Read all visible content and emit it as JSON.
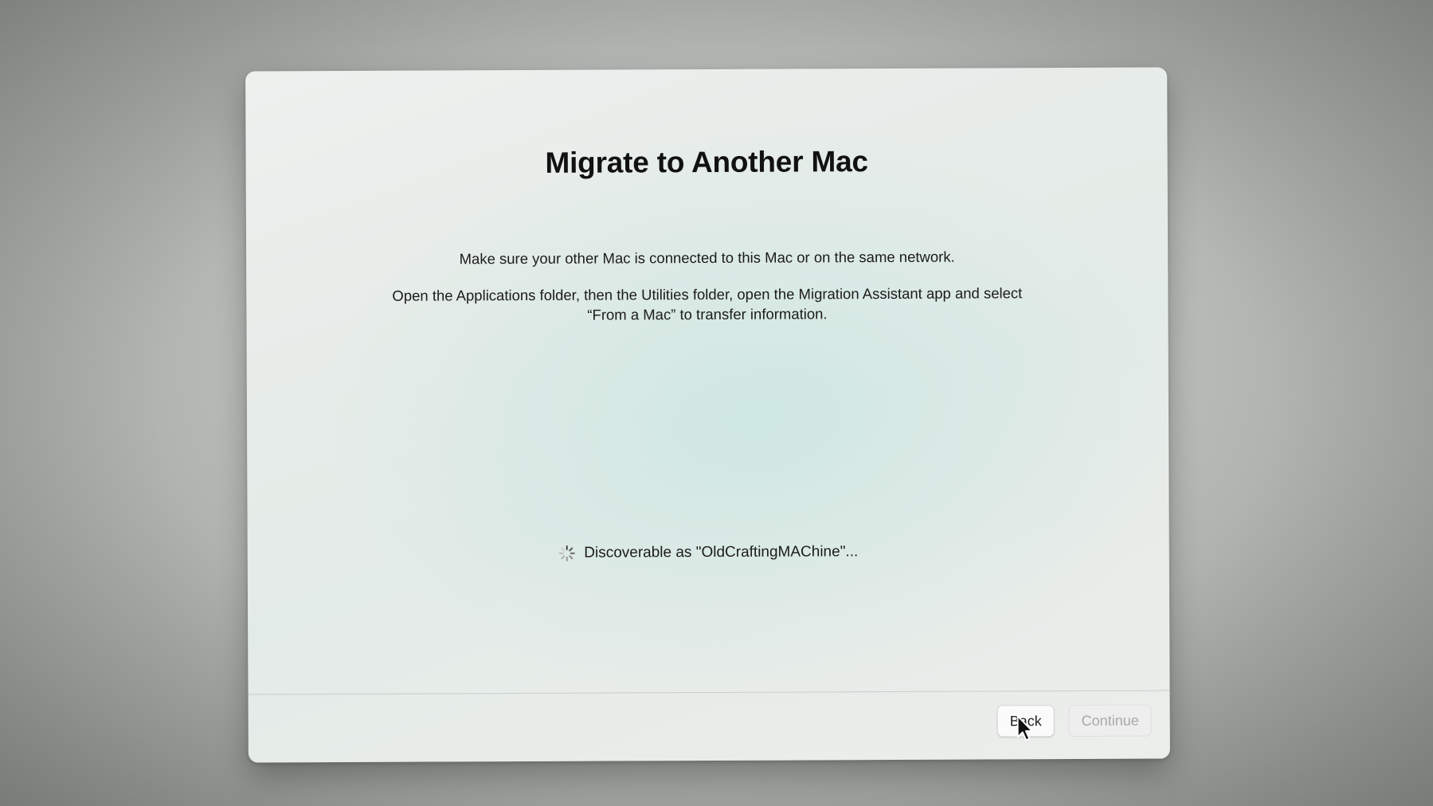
{
  "window": {
    "title": "Migrate to Another Mac",
    "instruction_1": "Make sure your other Mac is connected to this Mac or on the same network.",
    "instruction_2": "Open the Applications folder, then the Utilities folder, open the Migration Assistant app and select “From a Mac” to transfer information.",
    "status_text": "Discoverable as \"OldCraftingMAChine\"...",
    "status_icon": "spinner-icon"
  },
  "footer": {
    "back_label": "Back",
    "continue_label": "Continue",
    "continue_enabled": false
  },
  "colors": {
    "title_text": "#111111",
    "body_text": "#1b1b1b",
    "disabled_text": "#a9a9a9"
  },
  "icons": {
    "cursor": "mouse-pointer-icon",
    "spinner": "spinner-icon"
  }
}
